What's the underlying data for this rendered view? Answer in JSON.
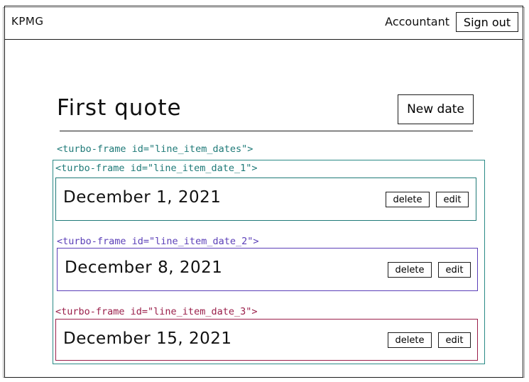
{
  "header": {
    "brand": "KPMG",
    "user_role": "Accountant",
    "sign_out_label": "Sign out"
  },
  "main": {
    "title": "First quote",
    "new_date_label": "New date",
    "frames_label": "<turbo-frame id=\"line_item_dates\">",
    "line_item_dates": [
      {
        "frame_label": "<turbo-frame id=\"line_item_date_1\">",
        "date": "December 1, 2021",
        "delete_label": "delete",
        "edit_label": "edit",
        "color": "#1f7a78"
      },
      {
        "frame_label": "<turbo-frame id=\"line_item_date_2\">",
        "date": "December 8, 2021",
        "delete_label": "delete",
        "edit_label": "edit",
        "color": "#5b3fb8"
      },
      {
        "frame_label": "<turbo-frame id=\"line_item_date_3\">",
        "date": "December 15, 2021",
        "delete_label": "delete",
        "edit_label": "edit",
        "color": "#9a1f4a"
      }
    ]
  }
}
